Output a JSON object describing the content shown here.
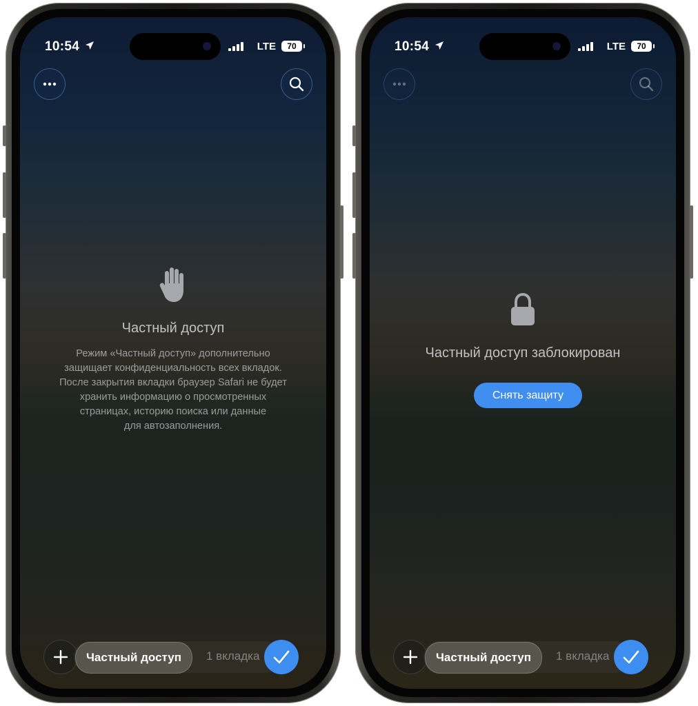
{
  "status_bar": {
    "time": "10:54",
    "network": "LTE",
    "battery": "70"
  },
  "left_screen": {
    "title": "Частный доступ",
    "description": "Режим «Частный доступ» дополнительно\nзащищает конфиденциальность всех вкладок.\nПосле закрытия вкладки браузер Safari не будет\nхранить информацию о просмотренных\nстраницах, историю поиска или данные\nдля автозаполнения.",
    "icon": "hand-raised-icon"
  },
  "right_screen": {
    "title": "Частный доступ заблокирован",
    "unlock_button": "Снять защиту",
    "icon": "lock-icon"
  },
  "bottom_bar": {
    "active_group": "Частный доступ",
    "tab_count": "1 вкладка"
  },
  "colors": {
    "accent": "#3e8ef2"
  }
}
